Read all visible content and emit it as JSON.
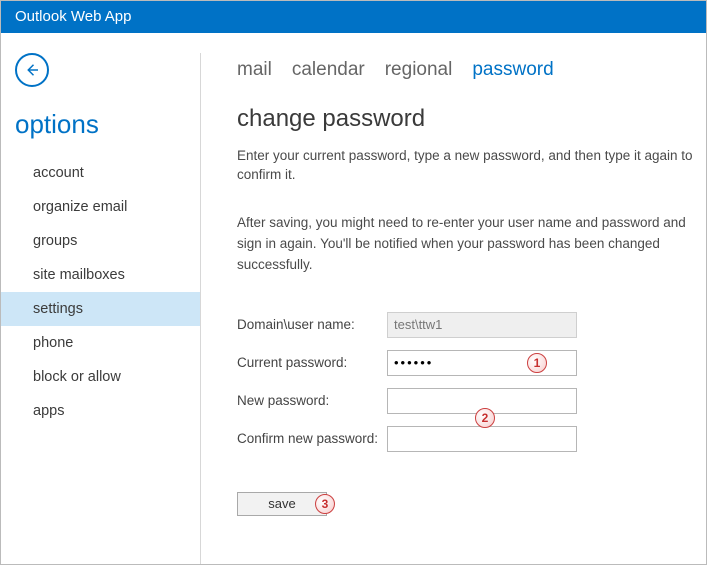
{
  "header": {
    "title": "Outlook Web App"
  },
  "left": {
    "options_label": "options",
    "items": [
      {
        "label": "account"
      },
      {
        "label": "organize email"
      },
      {
        "label": "groups"
      },
      {
        "label": "site mailboxes"
      },
      {
        "label": "settings",
        "active": true
      },
      {
        "label": "phone"
      },
      {
        "label": "block or allow"
      },
      {
        "label": "apps"
      }
    ]
  },
  "tabs": {
    "items": [
      {
        "label": "mail"
      },
      {
        "label": "calendar"
      },
      {
        "label": "regional"
      },
      {
        "label": "password",
        "active": true
      }
    ]
  },
  "page": {
    "title": "change password",
    "desc1": "Enter your current password, type a new password, and then type it again to confirm it.",
    "desc2": "After saving, you might need to re-enter your user name and password and sign in again. You'll be notified when your password has been changed successfully."
  },
  "form": {
    "domain_user_label": "Domain\\user name:",
    "domain_user_value": "test\\ttw1",
    "current_label": "Current password:",
    "current_value": "••••••",
    "new_label": "New password:",
    "new_value": "",
    "confirm_label": "Confirm new password:",
    "confirm_value": "",
    "save_label": "save"
  },
  "callouts": {
    "c1": "1",
    "c2": "2",
    "c3": "3"
  }
}
